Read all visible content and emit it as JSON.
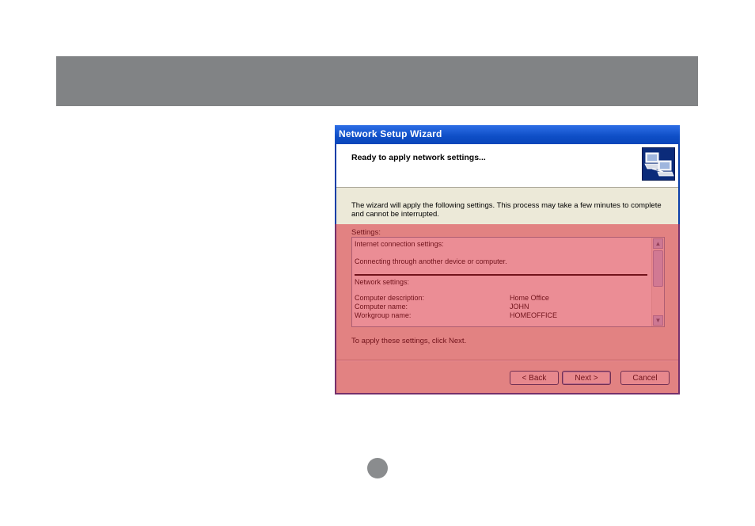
{
  "dialog": {
    "title": "Network Setup Wizard",
    "heading": "Ready to apply network settings...",
    "intro_line1": "The wizard will apply the following settings. This process may take a few minutes to complete",
    "intro_line2": "and cannot be interrupted.",
    "settings_label": "Settings:",
    "settings": {
      "internet_header": "Internet connection settings:",
      "internet_value": "Connecting through another device or computer.",
      "network_header": "Network settings:",
      "rows": [
        {
          "label": "Computer description:",
          "value": "Home Office"
        },
        {
          "label": "Computer name:",
          "value": "JOHN"
        },
        {
          "label": "Workgroup name:",
          "value": "HOMEOFFICE"
        }
      ]
    },
    "footer_note": "To apply these settings, click Next.",
    "buttons": {
      "back": "< Back",
      "next": "Next >",
      "cancel": "Cancel"
    },
    "icon": "network-computers-icon"
  },
  "colors": {
    "header_bar": "#818385",
    "highlight_overlay": "#d82434",
    "titlebar": "#0e4ec6"
  },
  "icons": {
    "scroll_up": "▲",
    "scroll_down": "▼"
  }
}
